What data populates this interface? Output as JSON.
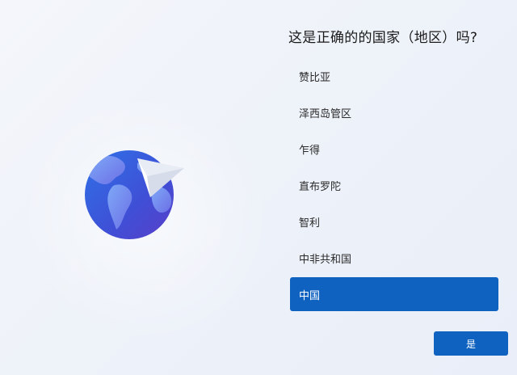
{
  "page": {
    "title": "这是正确的的国家（地区）吗?"
  },
  "illustration": {
    "icon": "globe-with-paper-plane"
  },
  "region_list": {
    "items": [
      {
        "label": "赞比亚",
        "selected": false
      },
      {
        "label": "泽西岛管区",
        "selected": false
      },
      {
        "label": "乍得",
        "selected": false
      },
      {
        "label": "直布罗陀",
        "selected": false
      },
      {
        "label": "智利",
        "selected": false
      },
      {
        "label": "中非共和国",
        "selected": false
      },
      {
        "label": "中国",
        "selected": true
      }
    ]
  },
  "actions": {
    "confirm_label": "是"
  },
  "colors": {
    "accent": "#0f62c0",
    "background": "#eef2f9",
    "globe_ocean": "#3a5fd8",
    "globe_land": "#6f8ff0"
  }
}
